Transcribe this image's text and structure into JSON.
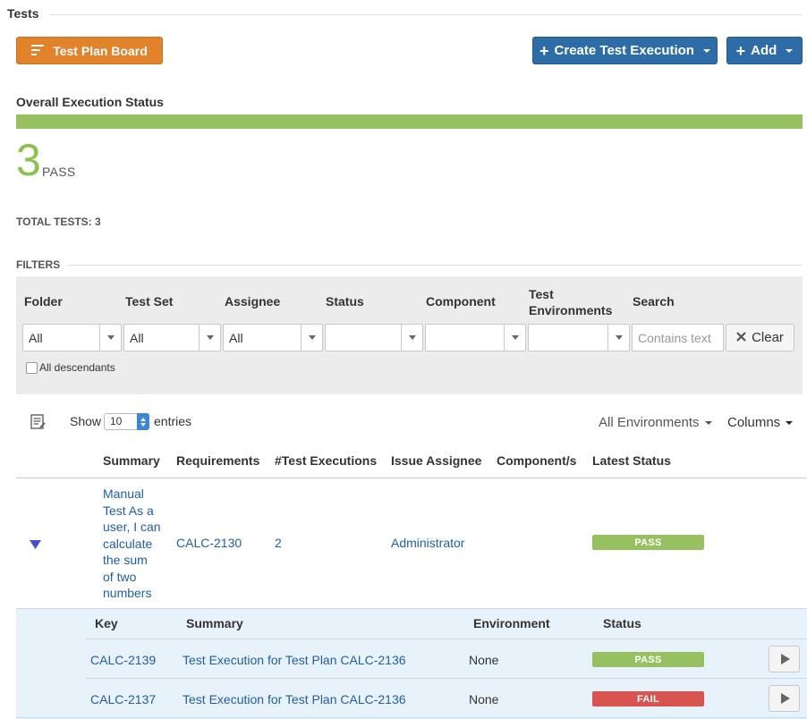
{
  "section": {
    "title": "Tests"
  },
  "toolbar": {
    "test_plan_board_label": "Test Plan Board",
    "create_test_execution_label": "Create Test Execution",
    "add_label": "Add"
  },
  "execution_status": {
    "title": "Overall Execution Status",
    "pass_fraction": 1.0,
    "pass_count": "3",
    "pass_label": "PASS",
    "total_tests": "TOTAL TESTS: 3",
    "colors": {
      "pass": "#97c160",
      "fail": "#d9534f"
    }
  },
  "filters": {
    "title": "FILTERS",
    "labels": {
      "folder": "Folder",
      "test_set": "Test Set",
      "assignee": "Assignee",
      "status": "Status",
      "component": "Component",
      "test_environments_line1": "Test",
      "test_environments_line2": "Environments",
      "search": "Search"
    },
    "values": {
      "folder": "All",
      "test_set": "All",
      "assignee": "All",
      "status": "",
      "component": "",
      "test_environments": ""
    },
    "search_placeholder": "Contains text",
    "clear_label": "Clear",
    "all_descendants_label": "All descendants"
  },
  "table_controls": {
    "show_label": "Show",
    "entries_value": "10",
    "entries_label": "entries",
    "environments_label": "All Environments",
    "columns_label": "Columns"
  },
  "table": {
    "headers": {
      "summary": "Summary",
      "requirements": "Requirements",
      "test_executions": "#Test Executions",
      "issue_assignee": "Issue Assignee",
      "components": "Component/s",
      "latest_status": "Latest Status"
    },
    "rows": [
      {
        "summary_lines": [
          "Manual",
          "Test As a",
          "user, I can",
          "calculate",
          "the sum",
          "of two",
          "numbers"
        ],
        "requirement": "CALC-2130",
        "test_executions": "2",
        "assignee": "Administrator",
        "component": "",
        "latest_status": "PASS"
      }
    ]
  },
  "sub_table": {
    "headers": {
      "key": "Key",
      "summary": "Summary",
      "environment": "Environment",
      "status": "Status"
    },
    "rows": [
      {
        "key": "CALC-2139",
        "summary": "Test Execution for Test Plan CALC-2136",
        "environment": "None",
        "status": "PASS"
      },
      {
        "key": "CALC-2137",
        "summary": "Test Execution for Test Plan CALC-2136",
        "environment": "None",
        "status": "FAIL"
      }
    ]
  }
}
